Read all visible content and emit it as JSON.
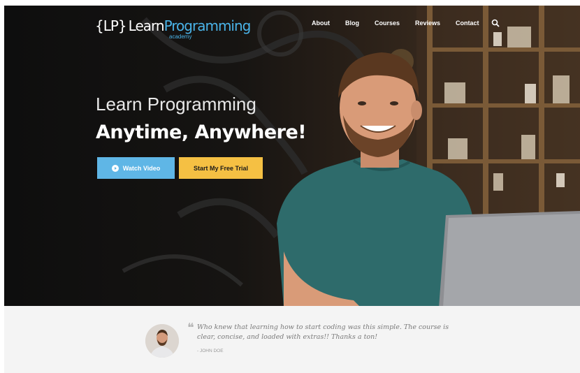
{
  "logo": {
    "mark": "{LP}",
    "text_left": "Learn",
    "text_right": "Programming",
    "sub": "academy"
  },
  "nav": {
    "items": [
      "About",
      "Blog",
      "Courses",
      "Reviews",
      "Contact"
    ],
    "search_icon": "search-icon"
  },
  "hero": {
    "headline_line1": "Learn Programming",
    "headline_line2": "Anytime, Anywhere!",
    "watch_button": "Watch Video",
    "trial_button": "Start My Free Trial"
  },
  "testimonial": {
    "quote": "Who knew that learning how to start coding was this simple. The course is clear, concise, and loaded with extras!! Thanks a ton!",
    "author": "- JOHN DOE"
  },
  "colors": {
    "accent_blue": "#5fb6e6",
    "accent_yellow": "#f5c043",
    "logo_blue": "#4ab3e8"
  }
}
